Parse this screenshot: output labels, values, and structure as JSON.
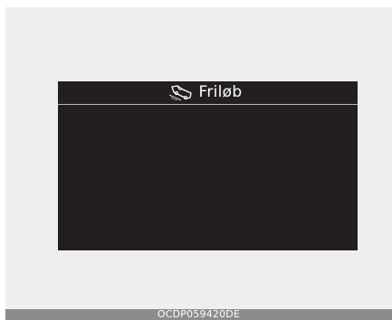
{
  "display": {
    "title": "Friløb",
    "icon": "coasting-car-icon",
    "background_color": "#231f20",
    "text_color": "#ffffff"
  },
  "footer": {
    "code": "OCDP059420DE"
  }
}
